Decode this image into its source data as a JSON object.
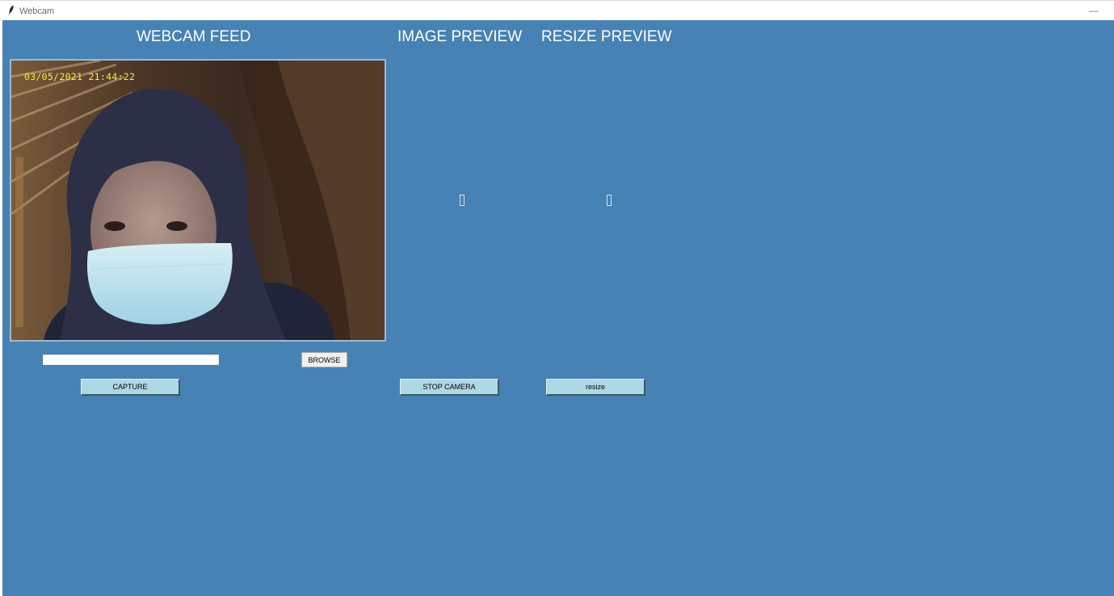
{
  "window": {
    "title": "Webcam",
    "icon": "feather-icon",
    "minimize_symbol": "—"
  },
  "headings": {
    "webcam_feed": "WEBCAM FEED",
    "image_preview": "IMAGE PREVIEW",
    "resize_preview": "RESIZE PREVIEW"
  },
  "feed": {
    "timestamp": "03/05/2021 21:44:22"
  },
  "path_input": {
    "value": "",
    "placeholder": ""
  },
  "buttons": {
    "browse": "BROWSE",
    "capture": "CAPTURE",
    "stop_camera": "STOP CAMERA",
    "resize": "resize"
  },
  "colors": {
    "background": "#4682b4",
    "button_blue": "#add8e6",
    "timestamp": "#f2ee3a"
  }
}
